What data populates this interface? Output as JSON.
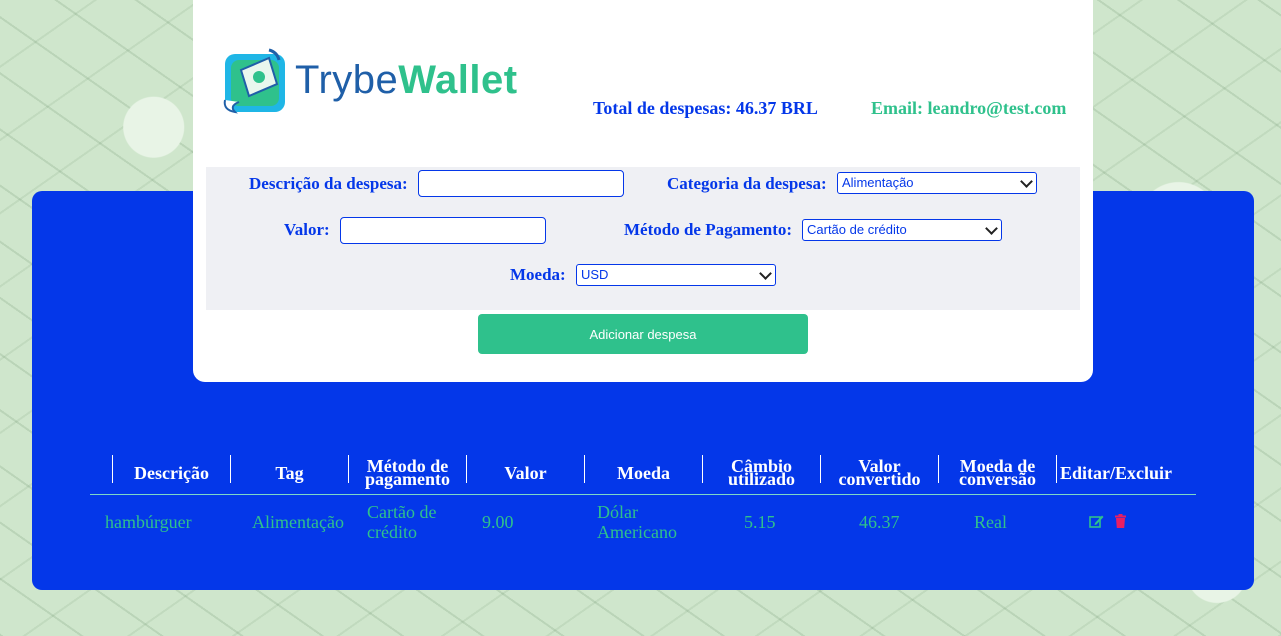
{
  "header": {
    "logo": {
      "word1": "Trybe",
      "word2": "Wallet"
    },
    "total": "Total de despesas: 46.37 BRL",
    "email": "Email: leandro@test.com"
  },
  "form": {
    "description_label": "Descrição da despesa:",
    "description_value": "",
    "category_label": "Categoria da despesa:",
    "category_value": "Alimentação",
    "value_label": "Valor:",
    "value_value": "",
    "payment_label": "Método de Pagamento:",
    "payment_value": "Cartão de crédito",
    "currency_label": "Moeda:",
    "currency_value": "USD",
    "add_button": "Adicionar despesa"
  },
  "table": {
    "headers": [
      "Descrição",
      "Tag",
      "Método de pagamento",
      "Valor",
      "Moeda",
      "Câmbio utilizado",
      "Valor convertido",
      "Moeda de conversão",
      "Editar/Excluir"
    ],
    "rows": [
      {
        "description": "hambúrguer",
        "tag": "Alimentação",
        "method": "Cartão de crédito",
        "value": "9.00",
        "currency": "Dólar Americano",
        "rate": "5.15",
        "converted": "46.37",
        "conversion_currency": "Real"
      }
    ]
  },
  "colors": {
    "primary_blue": "#0437e9",
    "accent_green": "#2fc18c",
    "delete_red": "#e91e63"
  },
  "icons": [
    "wallet-logo-icon",
    "edit-icon",
    "trash-icon"
  ]
}
